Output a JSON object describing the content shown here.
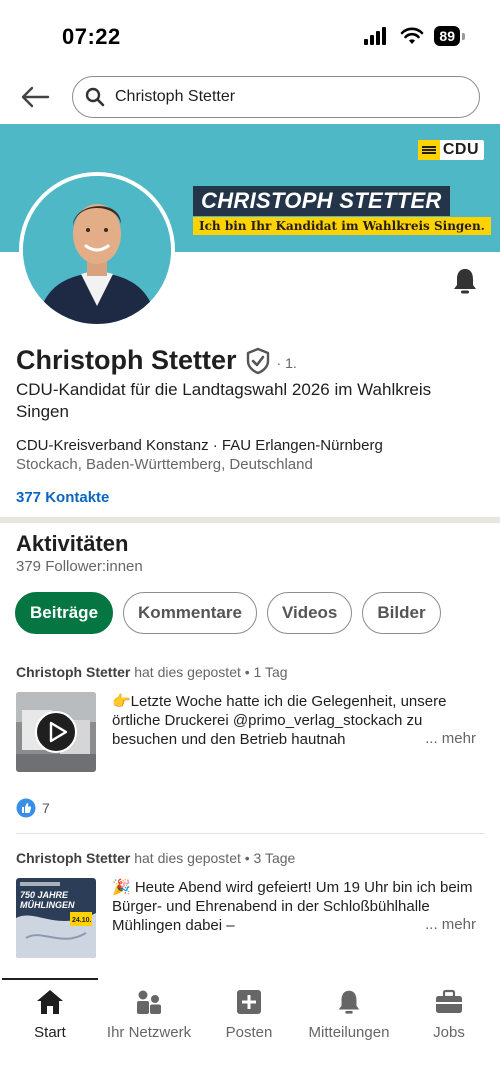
{
  "status_bar": {
    "time": "07:22",
    "battery": "89"
  },
  "search": {
    "value": "Christoph Stetter"
  },
  "banner": {
    "logo_text": "CDU",
    "name": "CHRISTOPH STETTER",
    "tagline": "Ich bin Ihr Kandidat im Wahlkreis Singen."
  },
  "profile": {
    "name": "Christoph Stetter",
    "degree": "· 1.",
    "headline": "CDU-Kandidat für die Landtagswahl 2026 im Wahlkreis Singen",
    "org": "CDU-Kreisverband Konstanz · FAU Erlangen-Nürnberg",
    "location": "Stockach, Baden-Württemberg, Deutschland",
    "connections": "377 Kontakte"
  },
  "activity": {
    "title": "Aktivitäten",
    "followers": "379 Follower:innen",
    "tabs": [
      {
        "label": "Beiträge",
        "active": true
      },
      {
        "label": "Kommentare",
        "active": false
      },
      {
        "label": "Videos",
        "active": false
      },
      {
        "label": "Bilder",
        "active": false
      }
    ]
  },
  "posts": [
    {
      "author": "Christoph Stetter",
      "action": " hat dies gepostet • 1 Tag",
      "text": "👉Letzte Woche hatte ich die Gelegenheit, unsere örtliche Druckerei @primo_verlag_stockach zu besuchen und den Betrieb hautnah",
      "more": "... mehr",
      "reactions": "7"
    },
    {
      "author": "Christoph Stetter",
      "action": " hat dies gepostet • 3 Tage",
      "text": "🎉 Heute Abend wird gefeiert! Um 19 Uhr bin ich beim Bürger- und Ehrenabend in der Schloßbühlhalle Mühlingen dabei –",
      "more": "... mehr",
      "thumb_title": "750 JAHRE MÜHLINGEN",
      "thumb_date": "24.10."
    }
  ],
  "bottom_nav": [
    {
      "label": "Start",
      "icon": "home-icon",
      "active": true
    },
    {
      "label": "Ihr Netzwerk",
      "icon": "network-icon",
      "active": false
    },
    {
      "label": "Posten",
      "icon": "plus-square-icon",
      "active": false
    },
    {
      "label": "Mitteilungen",
      "icon": "bell-icon",
      "active": false
    },
    {
      "label": "Jobs",
      "icon": "briefcase-icon",
      "active": false
    }
  ],
  "colors": {
    "accent_green": "#057642",
    "link_blue": "#0a66c2",
    "banner_teal": "#4fb8c6",
    "cdu_yellow": "#ffd200"
  }
}
